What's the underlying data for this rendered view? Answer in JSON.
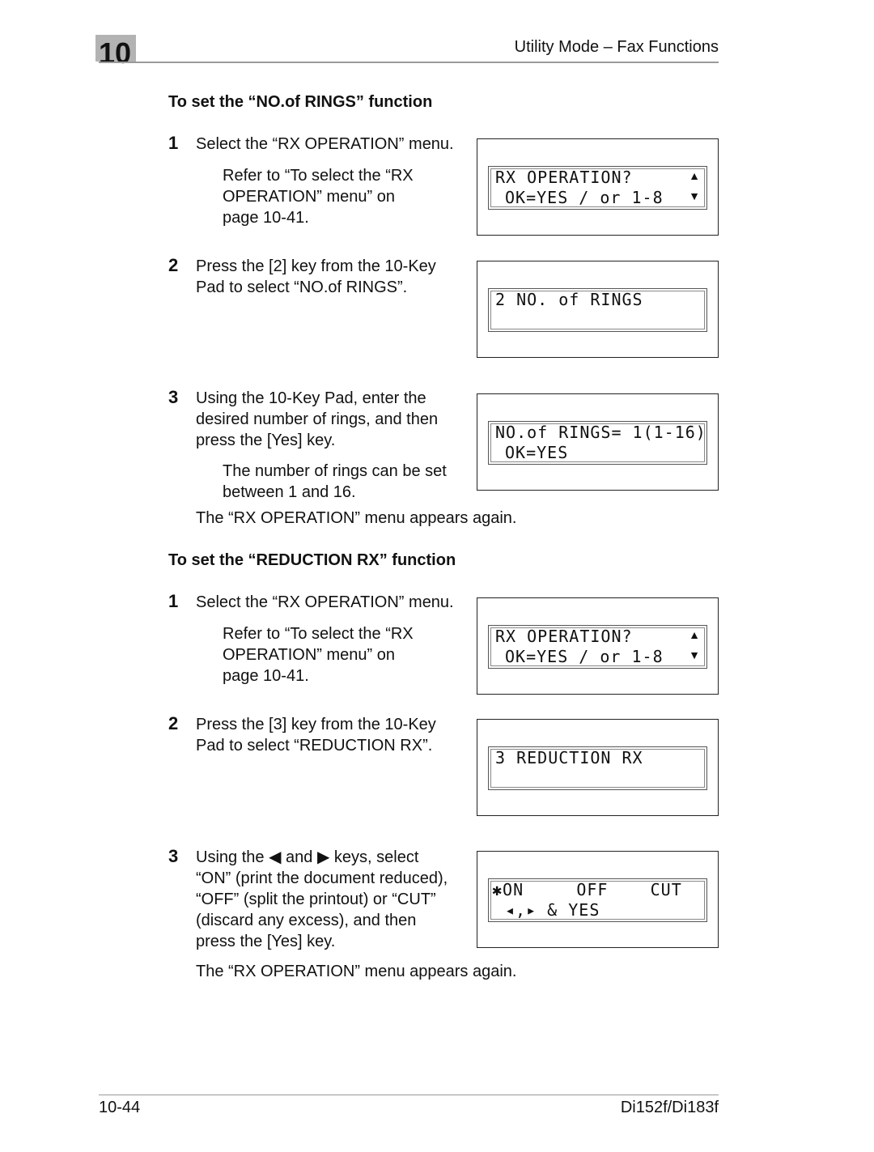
{
  "header": {
    "chapter": "10",
    "title": "Utility Mode – Fax Functions"
  },
  "rings": {
    "heading": "To set the “NO.of RINGS” function",
    "steps": [
      {
        "num": "1",
        "text": [
          "Select the “RX OPERATION” menu."
        ],
        "note": [
          "Refer to “To select the “RX",
          "OPERATION” menu” on",
          "page 10-41."
        ],
        "lcd": [
          "RX OPERATION?",
          "OK=YES / or 1-8"
        ]
      },
      {
        "num": "2",
        "text": [
          "Press the [2] key from the 10-Key",
          "Pad to select “NO.of RINGS”."
        ],
        "lcd": [
          "2 NO. of RINGS",
          ""
        ]
      },
      {
        "num": "3",
        "text": [
          "Using the 10-Key Pad, enter the",
          "desired number of rings, and then",
          "press the [Yes] key."
        ],
        "note": [
          "The number of rings can be set",
          "between 1 and 16."
        ],
        "lcd": [
          "NO.of RINGS= 1(1-16)",
          "OK=YES"
        ]
      }
    ],
    "after": "The “RX OPERATION” menu appears again."
  },
  "reduction": {
    "heading": "To set the “REDUCTION RX” function",
    "steps": [
      {
        "num": "1",
        "text": [
          "Select the “RX OPERATION” menu."
        ],
        "note": [
          "Refer to “To select the “RX",
          "OPERATION” menu” on",
          "page 10-41."
        ],
        "lcd": [
          "RX OPERATION?",
          "OK=YES / or 1-8"
        ]
      },
      {
        "num": "2",
        "text": [
          "Press the [3] key from the 10-Key",
          "Pad to select “REDUCTION RX”."
        ],
        "lcd": [
          "3 REDUCTION RX",
          ""
        ]
      },
      {
        "num": "3",
        "text_a": "Using the",
        "text_b": "and",
        "text_c": "keys, select",
        "text": [
          "“ON” (print the document reduced),",
          "“OFF” (split the printout) or “CUT”",
          "(discard any excess), and then",
          "press the [Yes] key."
        ],
        "lcd": [
          "✱ON     OFF    CUT",
          "◂,▸ & YES"
        ]
      }
    ],
    "after": "The “RX OPERATION” menu appears again."
  },
  "footer": {
    "page": "10-44",
    "model": "Di152f/Di183f"
  }
}
